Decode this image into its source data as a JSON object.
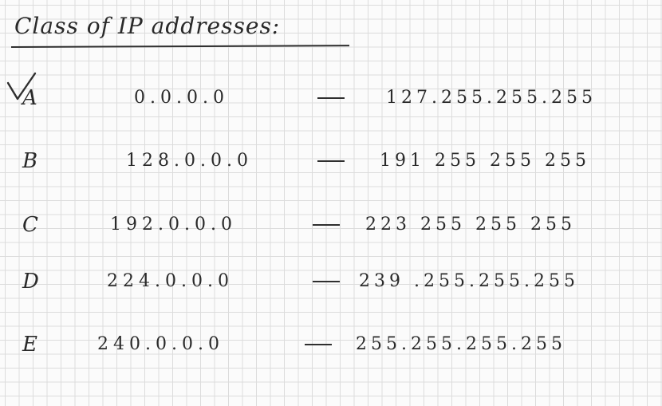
{
  "title": "Class of IP addresses:",
  "rows": [
    {
      "class": "A",
      "start": "0.0.0.0",
      "end": "127.255.255.255"
    },
    {
      "class": "B",
      "start": "128.0.0.0",
      "end": "191 255 255 255"
    },
    {
      "class": "C",
      "start": "192.0.0.0",
      "end": "223 255 255 255"
    },
    {
      "class": "D",
      "start": "224.0.0.0",
      "end": "239 .255.255.255"
    },
    {
      "class": "E",
      "start": "240.0.0.0",
      "end": "255.255.255.255"
    }
  ],
  "colors": {
    "ink": "#2a2a2a",
    "grid": "#dcdcdc",
    "paper": "#fbfbfb"
  },
  "icons": {
    "check": "checkmark-icon"
  }
}
